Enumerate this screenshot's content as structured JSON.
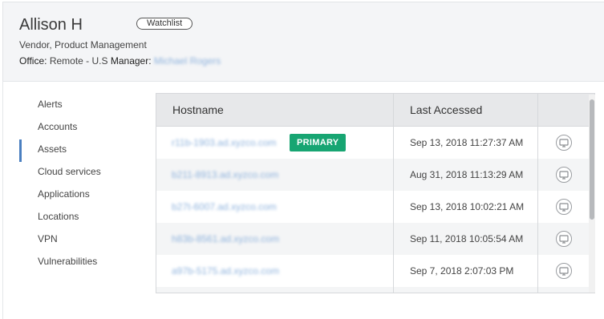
{
  "profile": {
    "name": "Allison H",
    "badge": "Watchlist",
    "role": "Vendor, Product Management",
    "office_label": "Office:",
    "office_value": "Remote - U.S",
    "manager_label": "Manager:",
    "manager_value": "Michael Rogers"
  },
  "nav": {
    "items": [
      "Alerts",
      "Accounts",
      "Assets",
      "Cloud services",
      "Applications",
      "Locations",
      "VPN",
      "Vulnerabilities"
    ],
    "active": "Assets"
  },
  "table": {
    "columns": [
      "Hostname",
      "Last Accessed",
      ""
    ],
    "rows": [
      {
        "hostname": "r11b-1903.ad.xyzco.com",
        "primary": "PRIMARY",
        "last_accessed": "Sep 13, 2018 11:27:37 AM",
        "action_icon": "remote-desktop-icon"
      },
      {
        "hostname": "b211-8913.ad.xyzco.com",
        "primary": "",
        "last_accessed": "Aug 31, 2018 11:13:29 AM",
        "action_icon": "remote-desktop-icon"
      },
      {
        "hostname": "b27t-6007.ad.xyzco.com",
        "primary": "",
        "last_accessed": "Sep 13, 2018 10:02:21 AM",
        "action_icon": "remote-desktop-icon"
      },
      {
        "hostname": "h83b-8561.ad.xyzco.com",
        "primary": "",
        "last_accessed": "Sep 11, 2018 10:05:54 AM",
        "action_icon": "remote-desktop-icon"
      },
      {
        "hostname": "a97b-5175.ad.xyzco.com",
        "primary": "",
        "last_accessed": "Sep 7, 2018 2:07:03 PM",
        "action_icon": "remote-desktop-icon"
      }
    ]
  },
  "colors": {
    "primary_badge": "#17a572",
    "active_nav": "#4a7fc0",
    "link": "#8fb3dd"
  }
}
